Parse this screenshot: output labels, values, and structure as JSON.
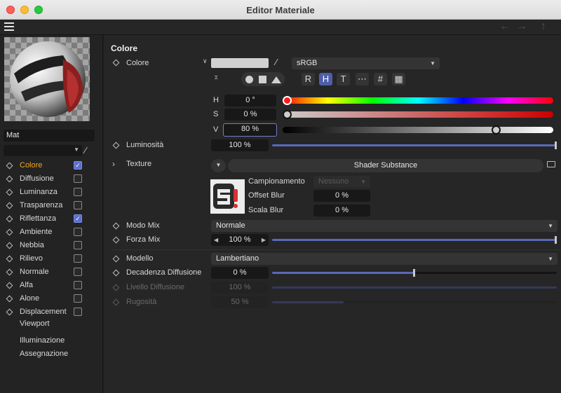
{
  "window": {
    "title": "Editor Materiale"
  },
  "sidebar": {
    "material_name": "Mat",
    "channels": [
      {
        "label": "Colore",
        "checked": true,
        "active": true
      },
      {
        "label": "Diffusione",
        "checked": false
      },
      {
        "label": "Luminanza",
        "checked": false
      },
      {
        "label": "Trasparenza",
        "checked": false
      },
      {
        "label": "Riflettanza",
        "checked": true
      },
      {
        "label": "Ambiente",
        "checked": false
      },
      {
        "label": "Nebbia",
        "checked": false
      },
      {
        "label": "Rilievo",
        "checked": false
      },
      {
        "label": "Normale",
        "checked": false
      },
      {
        "label": "Alfa",
        "checked": false
      },
      {
        "label": "Alone",
        "checked": false
      },
      {
        "label": "Displacement",
        "checked": false
      }
    ],
    "links": [
      "Viewport",
      "Illuminazione",
      "Assegnazione"
    ]
  },
  "colore": {
    "section_title": "Colore",
    "label": "Colore",
    "swatch_color": "#d0d0d0",
    "colorspace": "sRGB",
    "mode_buttons": [
      "R",
      "H",
      "T",
      "⋯",
      "#",
      "▦"
    ],
    "active_mode": "H",
    "h_label": "H",
    "h_value": "0 °",
    "h_fraction": 0.0,
    "s_label": "S",
    "s_value": "0 %",
    "s_fraction": 0.0,
    "v_label": "V",
    "v_value": "80 %",
    "v_fraction": 0.8
  },
  "luminosita": {
    "label": "Luminosità",
    "value": "100 %",
    "fraction": 1.0
  },
  "texture": {
    "label": "Texture",
    "shader_label": "Shader Substance",
    "campionamento_label": "Campionamento",
    "campionamento_value": "Nessuno",
    "offset_blur_label": "Offset Blur",
    "offset_blur_value": "0 %",
    "scala_blur_label": "Scala Blur",
    "scala_blur_value": "0 %"
  },
  "modo_mix": {
    "label": "Modo Mix",
    "value": "Normale"
  },
  "forza_mix": {
    "label": "Forza Mix",
    "value": "100 %",
    "fraction": 1.0
  },
  "modello": {
    "label": "Modello",
    "value": "Lambertiano"
  },
  "decadenza": {
    "label": "Decadenza Diffusione",
    "value": "0 %",
    "fraction": 0.5
  },
  "livello": {
    "label": "Livello Diffusione",
    "value": "100 %",
    "fraction": 1.0
  },
  "rugosita": {
    "label": "Rugosità",
    "value": "50 %",
    "fraction": 0.25
  },
  "colors": {
    "accent": "#5869ba",
    "active_channel": "#f5a623",
    "checkbox_on": "#5c6fd0"
  }
}
